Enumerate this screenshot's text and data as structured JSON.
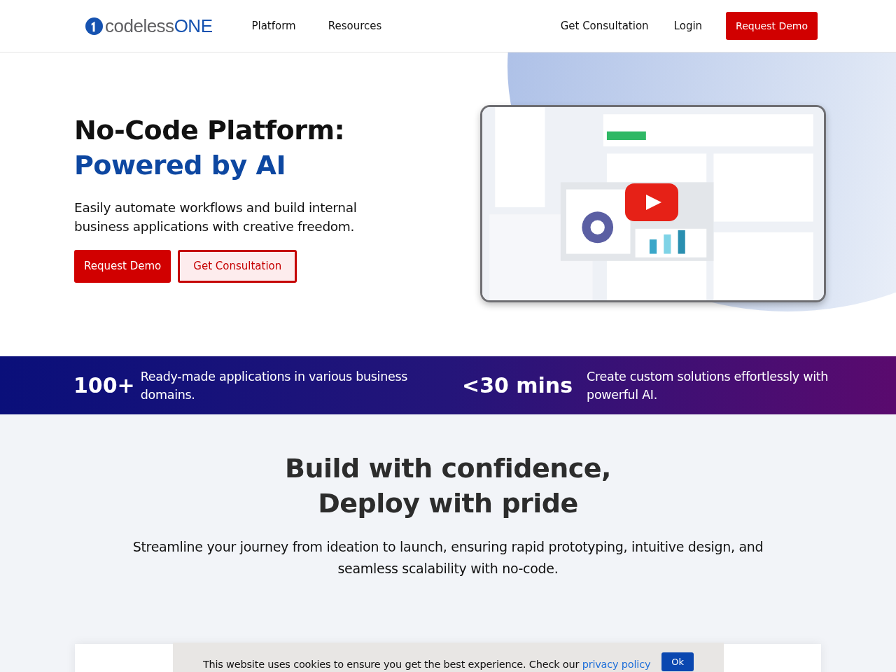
{
  "header": {
    "logo": {
      "main": "codeless",
      "accent": "ONE"
    },
    "nav": [
      {
        "label": "Platform"
      },
      {
        "label": "Resources"
      }
    ],
    "actions": [
      {
        "label": "Get Consultation",
        "kind": "link"
      },
      {
        "label": "Login",
        "kind": "link"
      },
      {
        "label": "Request Demo",
        "kind": "primary"
      }
    ]
  },
  "hero": {
    "title": "No-Code Platform:",
    "title_accent": "Powered by AI",
    "text": "Easily automate workflows and build internal business applications with creative freedom.",
    "buttons": [
      {
        "label": "Request Demo",
        "kind": "primary"
      },
      {
        "label": "Get Consultation",
        "kind": "outline"
      }
    ]
  },
  "stats": [
    {
      "value": "100+",
      "text": "Ready-made applications in various business domains."
    },
    {
      "value": "<30 mins",
      "text": "Create custom solutions effortlessly with powerful AI."
    }
  ],
  "section": {
    "title_lines": [
      "Build with confidence,",
      "Deploy with pride"
    ],
    "text": "Streamline your journey from ideation to launch, ensuring rapid prototyping, intuitive design, and seamless scalability with no-code."
  },
  "cookie": {
    "text": "This website uses cookies to ensure you get the best experience. Check our",
    "link": "privacy policy",
    "button": "Ok"
  }
}
